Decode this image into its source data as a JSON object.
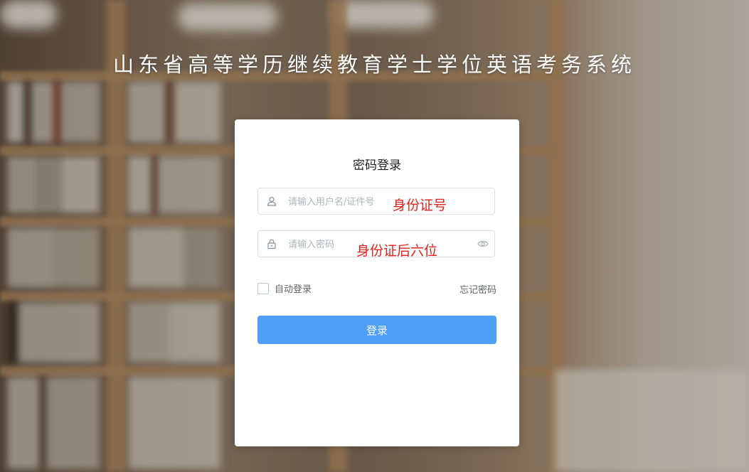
{
  "page": {
    "title": "山东省高等学历继续教育学士学位英语考务系统"
  },
  "login": {
    "heading": "密码登录",
    "username": {
      "placeholder": "请输入用户名/证件号",
      "value": "",
      "icon": "user-icon"
    },
    "password": {
      "placeholder": "请输入密码",
      "value": "",
      "icon": "lock-icon",
      "toggle_icon": "eye-icon"
    },
    "remember_label": "自动登录",
    "remember_checked": false,
    "forgot_label": "忘记密码",
    "submit_label": "登录"
  },
  "annotations": {
    "username_hint": "身份证号",
    "password_hint": "身份证后六位"
  },
  "colors": {
    "primary_button": "#4f9ef8",
    "annotation_red": "#e4221b",
    "card_bg": "#ffffff"
  }
}
